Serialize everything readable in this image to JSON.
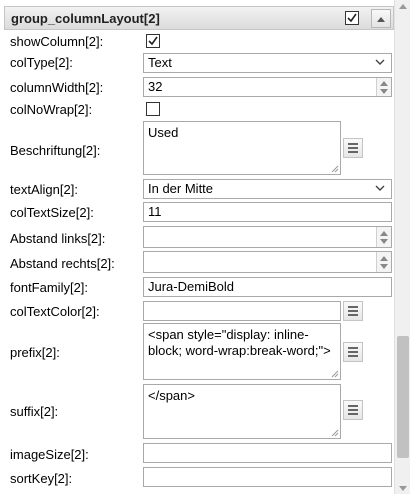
{
  "group": {
    "title": "group_columnLayout[2]",
    "checked": true
  },
  "rows": {
    "showColumn": {
      "label": "showColumn[2]:",
      "checked": true
    },
    "colType": {
      "label": "colType[2]:",
      "value": "Text"
    },
    "columnWidth": {
      "label": "columnWidth[2]:",
      "value": "32"
    },
    "colNoWrap": {
      "label": "colNoWrap[2]:",
      "checked": false
    },
    "beschriftung": {
      "label": "Beschriftung[2]:",
      "value": "Used"
    },
    "textAlign": {
      "label": "textAlign[2]:",
      "value": "In der Mitte"
    },
    "colTextSize": {
      "label": "colTextSize[2]:",
      "value": "11"
    },
    "abstandLinks": {
      "label": "Abstand links[2]:",
      "value": ""
    },
    "abstandRechts": {
      "label": "Abstand rechts[2]:",
      "value": ""
    },
    "fontFamily": {
      "label": "fontFamily[2]:",
      "value": "Jura-DemiBold"
    },
    "colTextColor": {
      "label": "colTextColor[2]:",
      "value": ""
    },
    "prefix": {
      "label": "prefix[2]:",
      "value": "<span style=\"display: inline-block; word-wrap:break-word;\">"
    },
    "suffix": {
      "label": "suffix[2]:",
      "value": "</span>"
    },
    "imageSize": {
      "label": "imageSize[2]:",
      "value": ""
    },
    "sortKey": {
      "label": "sortKey[2]:",
      "value": ""
    }
  },
  "icons": {
    "checkmark": "checkmark-icon",
    "collapse": "chevron-up-icon",
    "dropdown": "chevron-down-icon",
    "spinner": "spinner-arrows-icon",
    "editor": "list-editor-icon"
  }
}
